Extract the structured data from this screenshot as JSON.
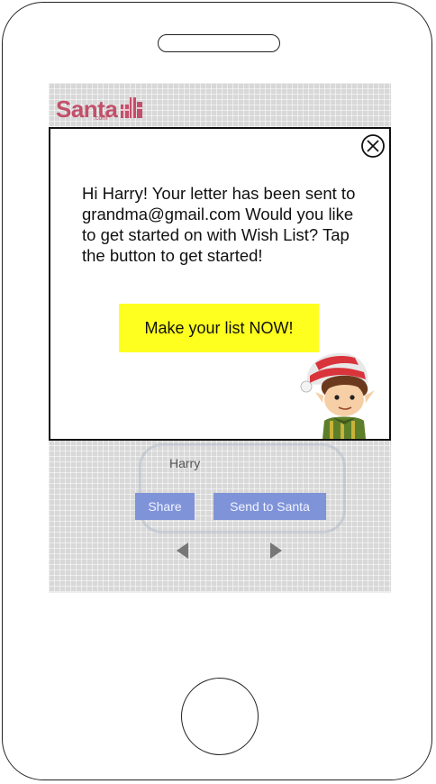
{
  "app": {
    "logo_text": "Santa",
    "logo_subtext": ".com"
  },
  "modal": {
    "message": "Hi Harry! Your letter has been sent to grandma@gmail.com Would you like to get started on with Wish List? Tap the button to get started!",
    "cta_label": "Make your list NOW!",
    "close_icon": "close-circle-x-icon",
    "illustration": "elf-character"
  },
  "background": {
    "recipient_name": "Harry",
    "share_label": "Share",
    "send_label": "Send to Santa",
    "prev_icon": "arrow-left-icon",
    "next_icon": "arrow-right-icon"
  },
  "colors": {
    "logo": "#c2506a",
    "cta_bg": "#ffff1f",
    "button_bg": "#7f93d9"
  }
}
